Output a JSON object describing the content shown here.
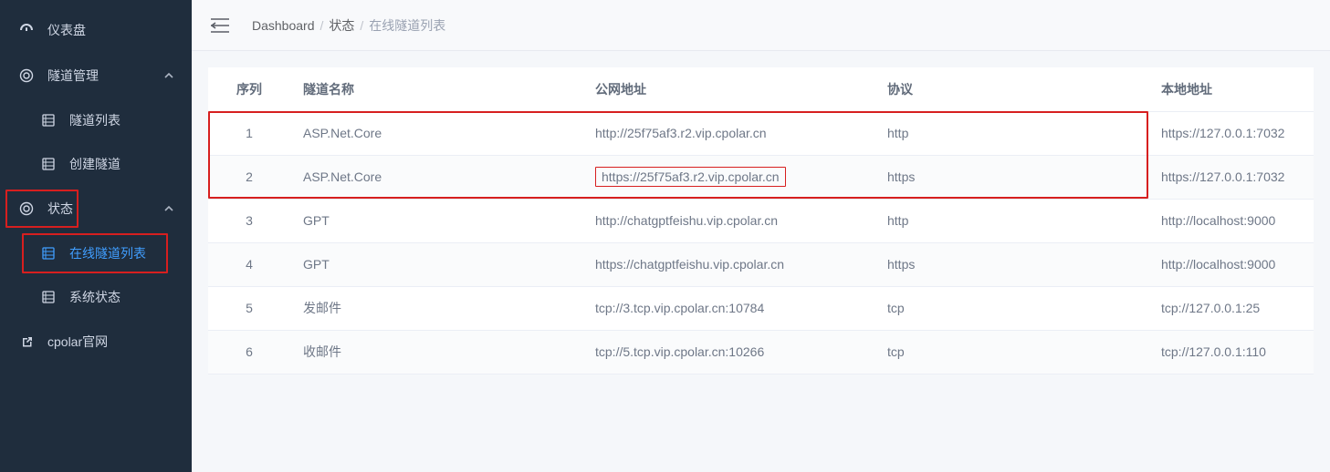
{
  "sidebar": {
    "items": [
      {
        "label": "仪表盘",
        "icon": "dashboard-icon",
        "kind": "top"
      },
      {
        "label": "隧道管理",
        "icon": "gear-icon",
        "kind": "group"
      },
      {
        "label": "隧道列表",
        "icon": "list-icon",
        "kind": "sub"
      },
      {
        "label": "创建隧道",
        "icon": "list-icon",
        "kind": "sub"
      },
      {
        "label": "状态",
        "icon": "gear-icon",
        "kind": "group"
      },
      {
        "label": "在线隧道列表",
        "icon": "list-icon",
        "kind": "sub",
        "active": true
      },
      {
        "label": "系统状态",
        "icon": "list-icon",
        "kind": "sub"
      },
      {
        "label": "cpolar官网",
        "icon": "external-icon",
        "kind": "top"
      }
    ]
  },
  "breadcrumb": {
    "items": [
      "Dashboard",
      "状态",
      "在线隧道列表"
    ]
  },
  "table": {
    "headers": [
      "序列",
      "隧道名称",
      "公网地址",
      "协议",
      "本地地址"
    ],
    "rows": [
      {
        "seq": "1",
        "name": "ASP.Net.Core",
        "addr": "http://25f75af3.r2.vip.cpolar.cn",
        "proto": "http",
        "local": "https://127.0.0.1:7032"
      },
      {
        "seq": "2",
        "name": "ASP.Net.Core",
        "addr": "https://25f75af3.r2.vip.cpolar.cn",
        "proto": "https",
        "local": "https://127.0.0.1:7032",
        "addr_hl": true
      },
      {
        "seq": "3",
        "name": "GPT",
        "addr": "http://chatgptfeishu.vip.cpolar.cn",
        "proto": "http",
        "local": "http://localhost:9000"
      },
      {
        "seq": "4",
        "name": "GPT",
        "addr": "https://chatgptfeishu.vip.cpolar.cn",
        "proto": "https",
        "local": "http://localhost:9000"
      },
      {
        "seq": "5",
        "name": "发邮件",
        "addr": "tcp://3.tcp.vip.cpolar.cn:10784",
        "proto": "tcp",
        "local": "tcp://127.0.0.1:25"
      },
      {
        "seq": "6",
        "name": "收邮件",
        "addr": "tcp://5.tcp.vip.cpolar.cn:10266",
        "proto": "tcp",
        "local": "tcp://127.0.0.1:110"
      }
    ]
  },
  "highlights": {
    "sidebar_status": true,
    "sidebar_online_list": true,
    "table_rows_1_2": true
  }
}
